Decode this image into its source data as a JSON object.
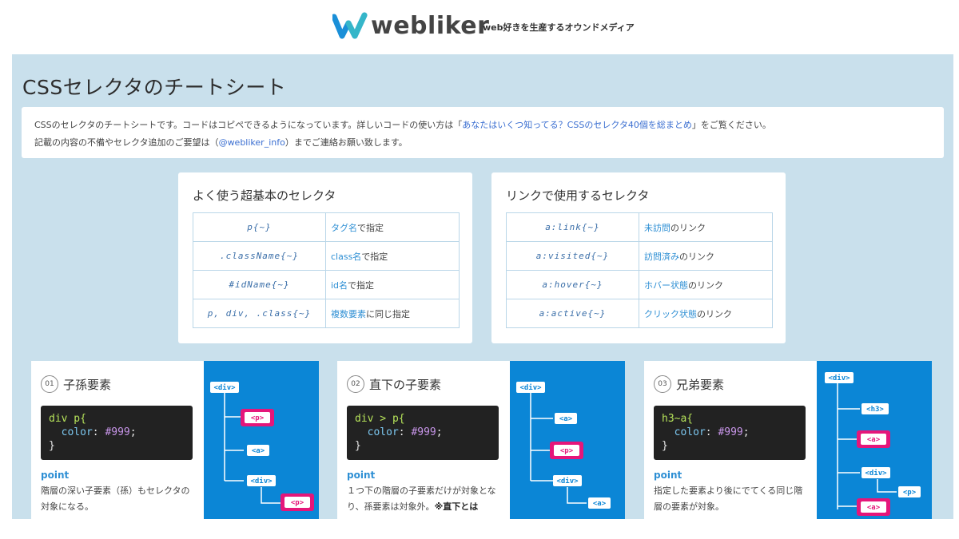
{
  "header": {
    "logo_text": "webliker",
    "tagline": "web好きを生産するオウンドメディア"
  },
  "colors": {
    "accent": "#2e8fd4",
    "panel_bg": "#c9e0ec",
    "diagram_bg": "#0b86d6",
    "highlight": "#e5167a"
  },
  "page_title": "CSSセレクタのチートシート",
  "intro": {
    "line1_a": "CSSのセレクタのチートシートです。コードはコピペできるようになっています。詳しいコードの使い方は「",
    "line1_link": "あなたはいくつ知ってる？CSSのセレクタ40個を総まとめ",
    "line1_b": "」をご覧ください。",
    "line2_a": "記載の内容の不備やセレクタ追加のご要望は（",
    "line2_link": "@webliker_info",
    "line2_b": "）までご連絡お願い致します。"
  },
  "basic_selectors": {
    "title": "よく使う超基本のセレクタ",
    "rows": [
      {
        "code": "p{~}",
        "hl": "タグ名",
        "rest": "で指定"
      },
      {
        "code": ".className{~}",
        "hl": "class名",
        "rest": "で指定"
      },
      {
        "code": "#idName{~}",
        "hl": "id名",
        "rest": "で指定"
      },
      {
        "code": "p, div, .class{~}",
        "hl": "複数要素",
        "rest": "に同じ指定"
      }
    ]
  },
  "link_selectors": {
    "title": "リンクで使用するセレクタ",
    "rows": [
      {
        "code": "a:link{~}",
        "hl": "未訪問",
        "rest": "のリンク"
      },
      {
        "code": "a:visited{~}",
        "hl": "訪問済み",
        "rest": "のリンク"
      },
      {
        "code": "a:hover{~}",
        "hl": "ホバー状態",
        "rest": "のリンク"
      },
      {
        "code": "a:active{~}",
        "hl": "クリック状態",
        "rest": "のリンク"
      }
    ]
  },
  "relations": [
    {
      "num": "01",
      "title": "子孫要素",
      "code_sel": "div p{",
      "code_prop": "color",
      "code_val": "#999",
      "code_close": "}",
      "point_label": "point",
      "point_text": "階層の深い子要素（孫）もセレクタの対象になる。"
    },
    {
      "num": "02",
      "title": "直下の子要素",
      "code_sel": "div > p{",
      "code_prop": "color",
      "code_val": "#999",
      "code_close": "}",
      "point_label": "point",
      "point_text_a": "１つ下の階層の子要素だけが対象となり、孫要素は対象外。",
      "point_text_b": "※直下とは"
    },
    {
      "num": "03",
      "title": "兄弟要素",
      "code_sel": "h3~a{",
      "code_prop": "color",
      "code_val": "#999",
      "code_close": "}",
      "point_label": "point",
      "point_text": "指定した要素より後にでてくる同じ階層の要素が対象。"
    }
  ],
  "diagram_tags": {
    "div": "<div>",
    "p": "<p>",
    "a": "<a>",
    "h3": "<h3>"
  }
}
